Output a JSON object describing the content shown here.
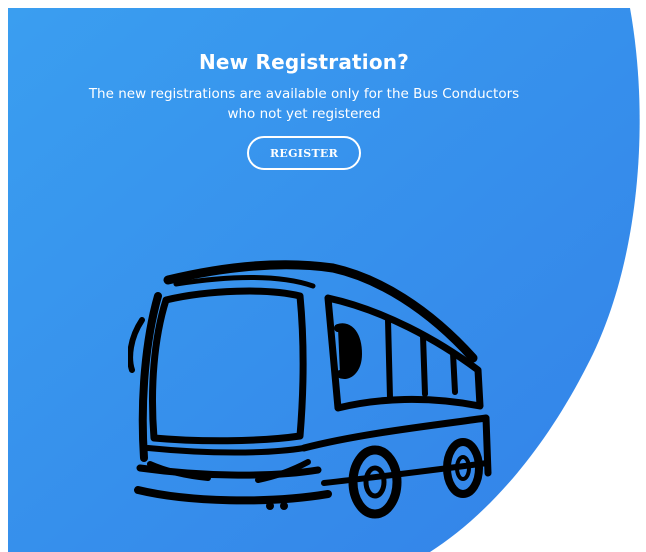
{
  "panel": {
    "title": "New Registration?",
    "description_line1": "The new registrations are available only for the Bus Conductors",
    "description_line2": "who not yet registered",
    "register_label": "REGISTER"
  },
  "colors": {
    "panel_gradient_start": "#3a9ef0",
    "panel_gradient_end": "#3382e8",
    "text": "#ffffff",
    "background": "#ffffff",
    "bus_ink": "#000000"
  },
  "icons": {
    "illustration": "bus-icon"
  }
}
